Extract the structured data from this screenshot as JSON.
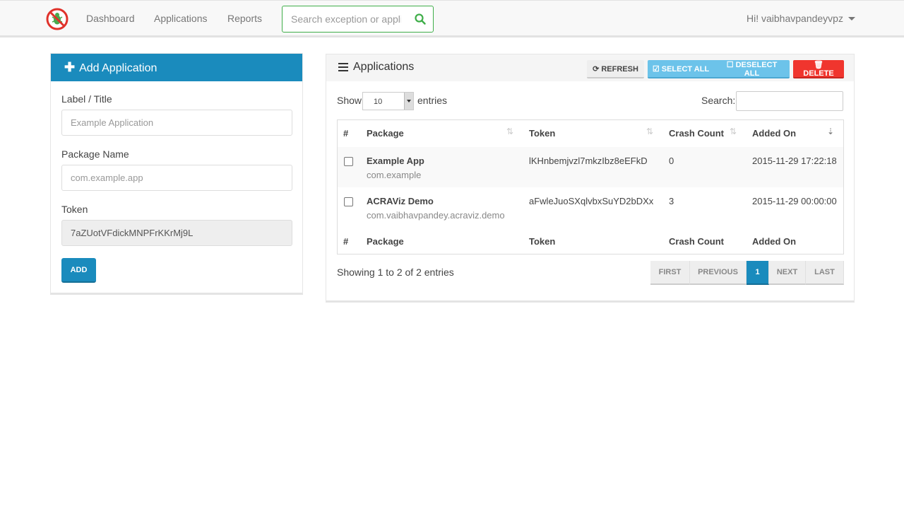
{
  "navbar": {
    "links": [
      "Dashboard",
      "Applications",
      "Reports"
    ],
    "search_placeholder": "Search exception or application",
    "user_greeting": "Hi! vaibhavpandeyvpz"
  },
  "add_panel": {
    "title": "Add Application",
    "label_title": "Label / Title",
    "label_placeholder": "Example Application",
    "package_label": "Package Name",
    "package_placeholder": "com.example.app",
    "token_label": "Token",
    "token_value": "7aZUotVFdickMNPFrKKrMj9L",
    "add_button": "ADD"
  },
  "apps_panel": {
    "title": "Applications",
    "buttons": {
      "refresh": "REFRESH",
      "select_all": "SELECT ALL",
      "deselect_all": "DESELECT ALL",
      "delete": "DELETE"
    },
    "show_label": "Show",
    "page_size": "10",
    "entries_label": "entries",
    "search_label": "Search:",
    "columns": [
      "#",
      "Package",
      "Token",
      "Crash Count",
      "Added On"
    ],
    "rows": [
      {
        "name": "Example App",
        "package": "com.example",
        "token": "lKHnbemjvzl7mkzIbz8eEFkD",
        "crashes": "0",
        "added": "2015-11-29 17:22:18"
      },
      {
        "name": "ACRAViz Demo",
        "package": "com.vaibhavpandey.acraviz.demo",
        "token": "aFwleJuoSXqlvbxSuYD2bDXx",
        "crashes": "3",
        "added": "2015-11-29 00:00:00"
      }
    ],
    "info": "Showing 1 to 2 of 2 entries",
    "pager": [
      "FIRST",
      "PREVIOUS",
      "1",
      "NEXT",
      "LAST"
    ]
  },
  "colors": {
    "brand": "#1a8bbd",
    "success": "#3fae49",
    "danger": "#f0352e",
    "info": "#6cc3ea"
  }
}
